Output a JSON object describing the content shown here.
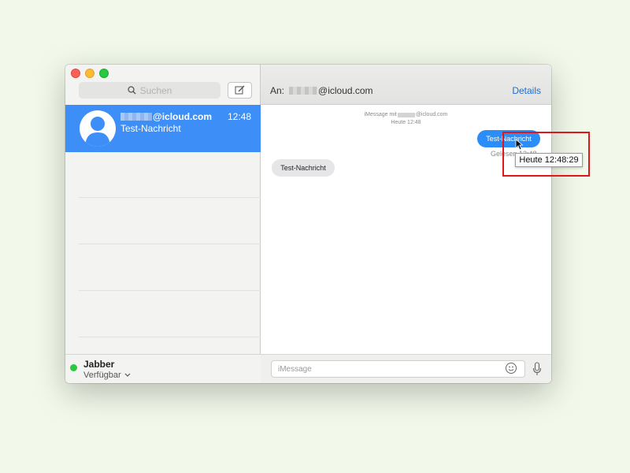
{
  "sidebar": {
    "search_placeholder": "Suchen",
    "conversation": {
      "name_suffix": "@icloud.com",
      "time": "12:48",
      "preview": "Test-Nachricht"
    },
    "footer": {
      "account": "Jabber",
      "status": "Verfügbar"
    }
  },
  "header": {
    "to_label": "An:",
    "recipient_suffix": "@icloud.com",
    "details_label": "Details"
  },
  "chat": {
    "meta_prefix": "iMessage mit",
    "meta_suffix": "@icloud.com",
    "meta_time": "Heute 12:48",
    "outgoing": "Test-Nachricht",
    "read_status": "Gelesen 12:48",
    "incoming": "Test-Nachricht",
    "tooltip": "Heute 12:48:29"
  },
  "composer": {
    "placeholder": "iMessage"
  },
  "colors": {
    "accent": "#3d8ff7",
    "bubble_out": "#2b8ef8",
    "bubble_in": "#e6e6e8",
    "highlight": "#e0161b",
    "status_green": "#28c840"
  }
}
